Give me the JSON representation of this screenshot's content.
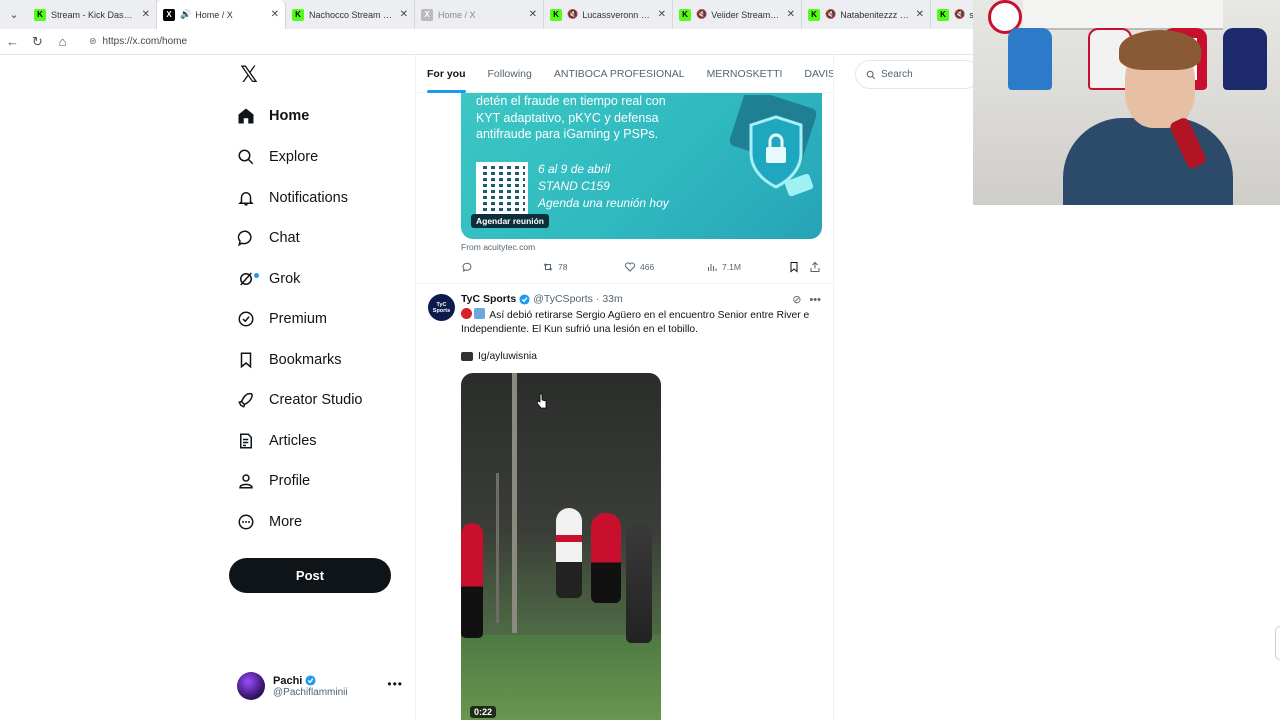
{
  "browser": {
    "tabs": [
      {
        "title": "Stream - Kick Dashboard",
        "favicon": "kick-icon",
        "active": false,
        "audio": false
      },
      {
        "title": "Home / X",
        "favicon": "x-icon",
        "active": true,
        "audio": true
      },
      {
        "title": "Nachocco Stream - Watch",
        "favicon": "kick-icon",
        "active": false,
        "audio": false
      },
      {
        "title": "Home / X",
        "favicon": "x-icon-gray",
        "active": false,
        "audio": false
      },
      {
        "title": "Lucassveronn Stream",
        "favicon": "kick-icon",
        "active": false,
        "audio": true
      },
      {
        "title": "Veiider Stream - Watch",
        "favicon": "kick-icon",
        "active": false,
        "audio": true
      },
      {
        "title": "Natabenitezzz Stream",
        "favicon": "kick-icon",
        "active": false,
        "audio": true
      },
      {
        "title": "s",
        "favicon": "kick-icon",
        "active": false,
        "audio": true
      }
    ],
    "url": "https://x.com/home"
  },
  "sidebar": {
    "items": [
      {
        "label": "Home",
        "icon": "home-icon"
      },
      {
        "label": "Explore",
        "icon": "search-icon"
      },
      {
        "label": "Notifications",
        "icon": "bell-icon"
      },
      {
        "label": "Chat",
        "icon": "chat-icon"
      },
      {
        "label": "Grok",
        "icon": "grok-icon"
      },
      {
        "label": "Premium",
        "icon": "verified-badge-icon"
      },
      {
        "label": "Bookmarks",
        "icon": "bookmark-icon"
      },
      {
        "label": "Creator Studio",
        "icon": "rocket-icon"
      },
      {
        "label": "Articles",
        "icon": "article-icon"
      },
      {
        "label": "Profile",
        "icon": "person-icon"
      },
      {
        "label": "More",
        "icon": "more-circle-icon"
      }
    ],
    "post_label": "Post",
    "account": {
      "name": "Pachi",
      "handle": "@Pachiflamminii"
    }
  },
  "feed_tabs": [
    "For you",
    "Following",
    "ANTIBOCA PROFESIONAL",
    "MERNOSKETTI",
    "DAVIS"
  ],
  "search": {
    "placeholder": "Search"
  },
  "ad": {
    "text_lines": [
      "detén el fraude en tiempo real con",
      "KYT adaptativo, pKYC y defensa",
      "antifraude para iGaming y PSPs."
    ],
    "event_lines": [
      "6 al 9 de abril",
      "STAND C159",
      "Agenda una reunión hoy"
    ],
    "cta": "Agendar reunión",
    "from": "From acuitytec.com",
    "stats": {
      "retweets": "78",
      "likes": "466",
      "views": "7.1M"
    }
  },
  "tweet": {
    "avatar_text": "TyC Sports",
    "name": "TyC Sports",
    "handle": "@TyCSports",
    "time": "· 33m",
    "text": "Así debió retirarse Sergio Agüero en el encuentro Senior entre River e Independiente. El Kun sufrió una lesión en el tobillo.",
    "credit": "Ig/ayluwisnia",
    "video_time": "0:22"
  },
  "colors": {
    "accent": "#1d9bf0",
    "text": "#0f1419",
    "muted": "#536471",
    "ad_bg": "#3cc7c4"
  }
}
